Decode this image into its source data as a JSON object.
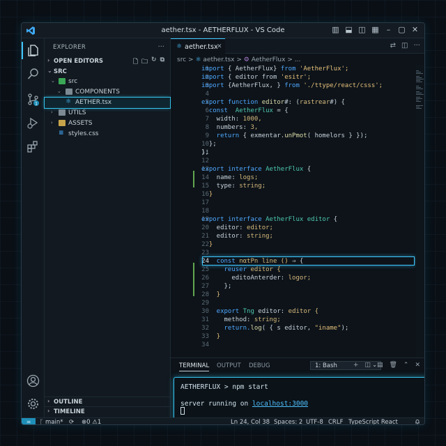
{
  "window": {
    "title": "aether.tsx - AETHERFLUX - VS Code"
  },
  "sidebar": {
    "header": "EXPLORER",
    "open_editors": "OPEN EDITORS",
    "root": "SRC",
    "tree": [
      {
        "label": "src"
      },
      {
        "label": "COMPONENTS"
      },
      {
        "label": "AETHER.tsx"
      },
      {
        "label": "UTILS"
      },
      {
        "label": "ASSETS"
      },
      {
        "label": "styles.css"
      }
    ],
    "outline": "OUTLINE",
    "timeline": "TIMELINE"
  },
  "editor": {
    "tab": "aether.tsx",
    "breadcrumb": {
      "src": "src",
      "sep": ">",
      "file": "aether.tsx",
      "symbol": "AetherFlux",
      "more": "..."
    },
    "lines": [
      "1",
      "2",
      "3",
      "4",
      "5",
      "6",
      "7",
      "8",
      "9",
      "10",
      "11",
      "12",
      "13",
      "14",
      "15",
      "16",
      "17",
      "18",
      "19",
      "20",
      "21",
      "22",
      "23",
      "24",
      "25",
      "26",
      "27",
      "28",
      "29",
      "30",
      "31",
      "32",
      "33",
      "34"
    ],
    "code": {
      "l1a": "import ",
      "l1b": "{ AetherFlux}",
      "l1c": " from ",
      "l1d": "'AetherFlux';",
      "l2a": "import ",
      "l2b": "{ editor from ",
      "l2c": "'esitr';",
      "l3a": "import ",
      "l3b": "{AetherFlux, }",
      "l3c": " from ",
      "l3d": "'./ttype/react/csss';",
      "l5a": "export ",
      "l5b": "function ",
      "l5c": "editor",
      "l5d": "#: (",
      "l5e": "rastrear",
      "l5f": "#) {",
      "l6a": "  const ",
      "l6b": " AetherFlux",
      "l6c": " = {",
      "l7a": "    width: ",
      "l7b": "1000,",
      "l8a": "    numbers: ",
      "l8b": "3,",
      "l9a": "    return ",
      "l9b": "{ exmentar.",
      "l9c": "unPmot",
      "l9d": "( homelors } });",
      "l10": "  };",
      "l11": "};",
      "l13a": "export ",
      "l13b": "interface ",
      "l13c": "AetherFlux",
      "l13d": " {",
      "l14a": "    name: ",
      "l14b": "logs;",
      "l15a": "    type: ",
      "l15b": "string;",
      "l16": "  }",
      "l19a": "export ",
      "l19b": "interface ",
      "l19c": "AetherFlux",
      "l19d": " editor",
      "l19e": " {",
      "l20a": "    editor: ",
      "l20b": "editor;",
      "l21a": "    editor: ",
      "l21b": "string;",
      "l22": "  }",
      "l24a": "    const ",
      "l24b": "nαtPn line ",
      "l24c": "() ",
      "l24d": "⇒ {",
      "l25a": "      reuser ",
      "l25b": "editor ",
      "l25c": "{",
      "l26a": "        editoAnterder: ",
      "l26b": "logor;",
      "l27": "      };",
      "l28": "    }",
      "l30a": "    export ",
      "l30b": "Tng ",
      "l30c": "editor: ",
      "l30d": "editor {",
      "l31a": "      method: ",
      "l31b": "string;",
      "l32a": "      return.",
      "l32b": "log",
      "l32c": "( { s editor, ",
      "l32d": "\"iname\"",
      "l32e": ");",
      "l33": "    }"
    }
  },
  "panel": {
    "tabs": [
      "TERMINAL",
      "OUTPUT",
      "DEBUG"
    ],
    "shell": "1: Bash",
    "terminal": {
      "prompt": "AETHERFLUX > npm start",
      "output_prefix": "server running on ",
      "url": "localhost:3000"
    }
  },
  "status": {
    "branch": "main*",
    "problems": "⊗0 ⚠1",
    "position": "Ln 24, Col 38",
    "spaces": "Spaces: 2",
    "encoding": "UTF-8",
    "eol": "CRLF",
    "language": "TypeScript React"
  },
  "colors": {
    "accent": "#3fc8ff",
    "background": "#0f141a"
  }
}
